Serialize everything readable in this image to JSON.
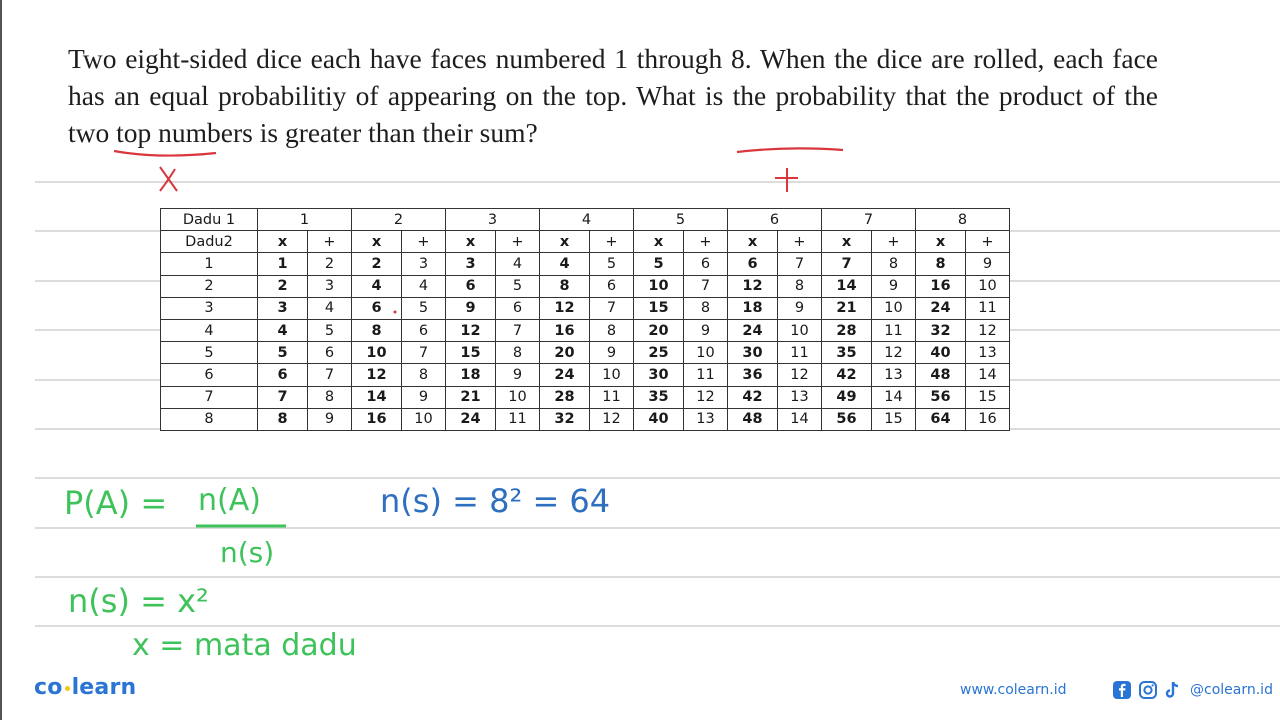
{
  "question": {
    "text": "Two eight-sided dice each have faces numbered 1 through 8. When the dice are rolled, each face has an equal probabilitiy of appearing on the top. What is the probability that the product of the two top numbers is greater than their sum?"
  },
  "annotations": {
    "product_mark": "X",
    "sum_mark": "+"
  },
  "table": {
    "corner_top": "Dadu 1",
    "corner_bottom": "Dadu2",
    "dadu1_values": [
      "1",
      "2",
      "3",
      "4",
      "5",
      "6",
      "7",
      "8"
    ],
    "op_product": "x",
    "op_sum": "+",
    "rows": [
      {
        "dadu2": "1",
        "cells": [
          [
            "1",
            "2"
          ],
          [
            "2",
            "3"
          ],
          [
            "3",
            "4"
          ],
          [
            "4",
            "5"
          ],
          [
            "5",
            "6"
          ],
          [
            "6",
            "7"
          ],
          [
            "7",
            "8"
          ],
          [
            "8",
            "9"
          ]
        ]
      },
      {
        "dadu2": "2",
        "cells": [
          [
            "2",
            "3"
          ],
          [
            "4",
            "4"
          ],
          [
            "6",
            "5"
          ],
          [
            "8",
            "6"
          ],
          [
            "10",
            "7"
          ],
          [
            "12",
            "8"
          ],
          [
            "14",
            "9"
          ],
          [
            "16",
            "10"
          ]
        ]
      },
      {
        "dadu2": "3",
        "cells": [
          [
            "3",
            "4"
          ],
          [
            "6",
            "5"
          ],
          [
            "9",
            "6"
          ],
          [
            "12",
            "7"
          ],
          [
            "15",
            "8"
          ],
          [
            "18",
            "9"
          ],
          [
            "21",
            "10"
          ],
          [
            "24",
            "11"
          ]
        ]
      },
      {
        "dadu2": "4",
        "cells": [
          [
            "4",
            "5"
          ],
          [
            "8",
            "6"
          ],
          [
            "12",
            "7"
          ],
          [
            "16",
            "8"
          ],
          [
            "20",
            "9"
          ],
          [
            "24",
            "10"
          ],
          [
            "28",
            "11"
          ],
          [
            "32",
            "12"
          ]
        ]
      },
      {
        "dadu2": "5",
        "cells": [
          [
            "5",
            "6"
          ],
          [
            "10",
            "7"
          ],
          [
            "15",
            "8"
          ],
          [
            "20",
            "9"
          ],
          [
            "25",
            "10"
          ],
          [
            "30",
            "11"
          ],
          [
            "35",
            "12"
          ],
          [
            "40",
            "13"
          ]
        ]
      },
      {
        "dadu2": "6",
        "cells": [
          [
            "6",
            "7"
          ],
          [
            "12",
            "8"
          ],
          [
            "18",
            "9"
          ],
          [
            "24",
            "10"
          ],
          [
            "30",
            "11"
          ],
          [
            "36",
            "12"
          ],
          [
            "42",
            "13"
          ],
          [
            "48",
            "14"
          ]
        ]
      },
      {
        "dadu2": "7",
        "cells": [
          [
            "7",
            "8"
          ],
          [
            "14",
            "9"
          ],
          [
            "21",
            "10"
          ],
          [
            "28",
            "11"
          ],
          [
            "35",
            "12"
          ],
          [
            "42",
            "13"
          ],
          [
            "49",
            "14"
          ],
          [
            "56",
            "15"
          ]
        ]
      },
      {
        "dadu2": "8",
        "cells": [
          [
            "8",
            "9"
          ],
          [
            "16",
            "10"
          ],
          [
            "24",
            "11"
          ],
          [
            "32",
            "12"
          ],
          [
            "40",
            "13"
          ],
          [
            "48",
            "14"
          ],
          [
            "56",
            "15"
          ],
          [
            "64",
            "16"
          ]
        ]
      }
    ]
  },
  "handwriting": {
    "probability_formula": "P(A) = n(A) / n(s)",
    "pa_lhs": "P(A) =",
    "numerator": "n(A)",
    "denominator": "n(s)",
    "sample_space": "n(s) = 8² = 64",
    "ns_general": "n(s) = x²",
    "x_definition": "x = mata dadu",
    "colors": {
      "green": "#3ec25a",
      "blue": "#2f6fbf",
      "red": "#d9363e"
    }
  },
  "footer": {
    "logo_left": "co",
    "logo_right": "learn",
    "website": "www.colearn.id",
    "social_handle": "@colearn.id",
    "brand_color": "#2a74d6"
  }
}
